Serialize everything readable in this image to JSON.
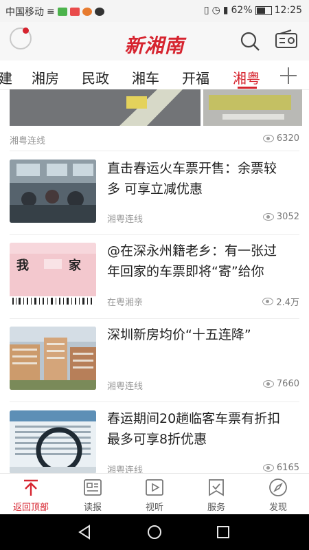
{
  "status": {
    "carrier": "中国移动",
    "battery": "62%",
    "time": "12:25"
  },
  "header": {
    "brand": "新湘南"
  },
  "tabs": [
    {
      "label": "建"
    },
    {
      "label": "湘房"
    },
    {
      "label": "民政"
    },
    {
      "label": "湘车"
    },
    {
      "label": "开福"
    },
    {
      "label": "湘粤"
    }
  ],
  "feed": {
    "top": {
      "source": "湘粤连线",
      "views": "6320"
    },
    "items": [
      {
        "title_line1": "直击春运火车票开售：余票较",
        "title_line2": "多 可享立减优惠",
        "source": "湘粤连线",
        "views": "3052"
      },
      {
        "title_line1": "@在深永州籍老乡：有一张过",
        "title_line2": "年回家的车票即将“寄”给你",
        "source": "在粤湘亲",
        "views": "2.4万"
      },
      {
        "title_line1": "深圳新房均价“十五连降”",
        "title_line2": "",
        "source": "湘粤连线",
        "views": "7660"
      },
      {
        "title_line1": "春运期间20趟临客车票有折扣",
        "title_line2": "最多可享8折优惠",
        "source": "湘粤连线",
        "views": "6165"
      }
    ]
  },
  "bottom_nav": [
    {
      "label": "返回顶部",
      "icon": "arrow-up-icon",
      "active": true
    },
    {
      "label": "读报",
      "icon": "newspaper-icon"
    },
    {
      "label": "视听",
      "icon": "play-icon"
    },
    {
      "label": "服务",
      "icon": "bookmark-check-icon"
    },
    {
      "label": "发现",
      "icon": "compass-icon"
    }
  ],
  "colors": {
    "accent": "#d6242f",
    "muted": "#999999"
  }
}
